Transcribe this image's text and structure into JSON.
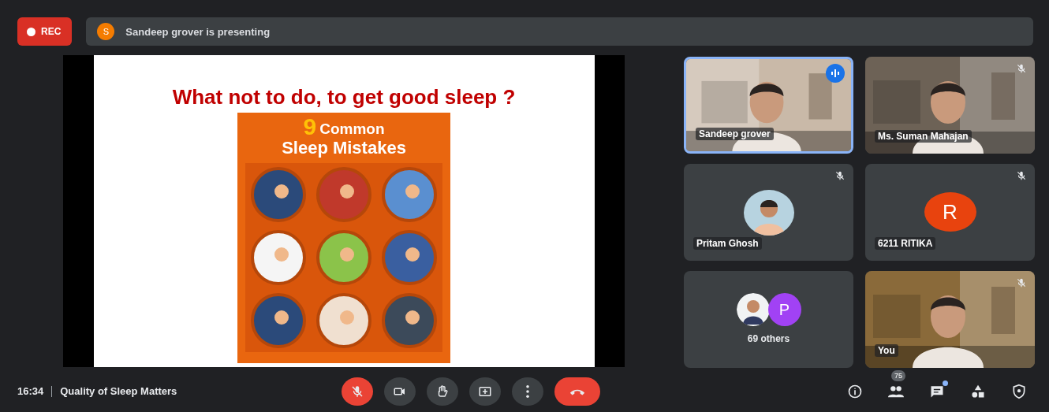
{
  "recording": {
    "label": "REC"
  },
  "presenter": {
    "initial": "S",
    "text": "Sandeep grover is presenting"
  },
  "slide": {
    "title": "What not to do, to get good sleep ?",
    "infographic_number": "9",
    "infographic_title_1": "Common",
    "infographic_title_2": "Sleep Mistakes"
  },
  "tiles": [
    {
      "kind": "video",
      "name": "Sandeep grover",
      "speaking": true,
      "muted": false
    },
    {
      "kind": "video",
      "name": "Ms. Suman Mahajan",
      "speaking": false,
      "muted": true
    },
    {
      "kind": "avatar",
      "name": "Pritam Ghosh",
      "speaking": false,
      "muted": true
    },
    {
      "kind": "letter",
      "name": "6211 RITIKA",
      "initial": "R",
      "color": "#e8430e",
      "speaking": false,
      "muted": true
    },
    {
      "kind": "others",
      "name": "69 others",
      "initial": "P",
      "color": "#a142f4",
      "speaking": false,
      "muted": false
    },
    {
      "kind": "video",
      "name": "You",
      "speaking": false,
      "muted": true
    }
  ],
  "footer": {
    "time": "16:34",
    "meeting_title": "Quality of Sleep Matters"
  },
  "controls": [
    {
      "kind": "mic",
      "danger": true
    },
    {
      "kind": "camera",
      "danger": false
    },
    {
      "kind": "hand",
      "danger": false
    },
    {
      "kind": "present",
      "danger": false
    },
    {
      "kind": "more",
      "danger": false
    },
    {
      "kind": "hangup",
      "danger": true
    }
  ],
  "side_controls": [
    {
      "kind": "info"
    },
    {
      "kind": "people",
      "badge": "75"
    },
    {
      "kind": "chat",
      "dot": true
    },
    {
      "kind": "activities"
    },
    {
      "kind": "safety"
    }
  ]
}
